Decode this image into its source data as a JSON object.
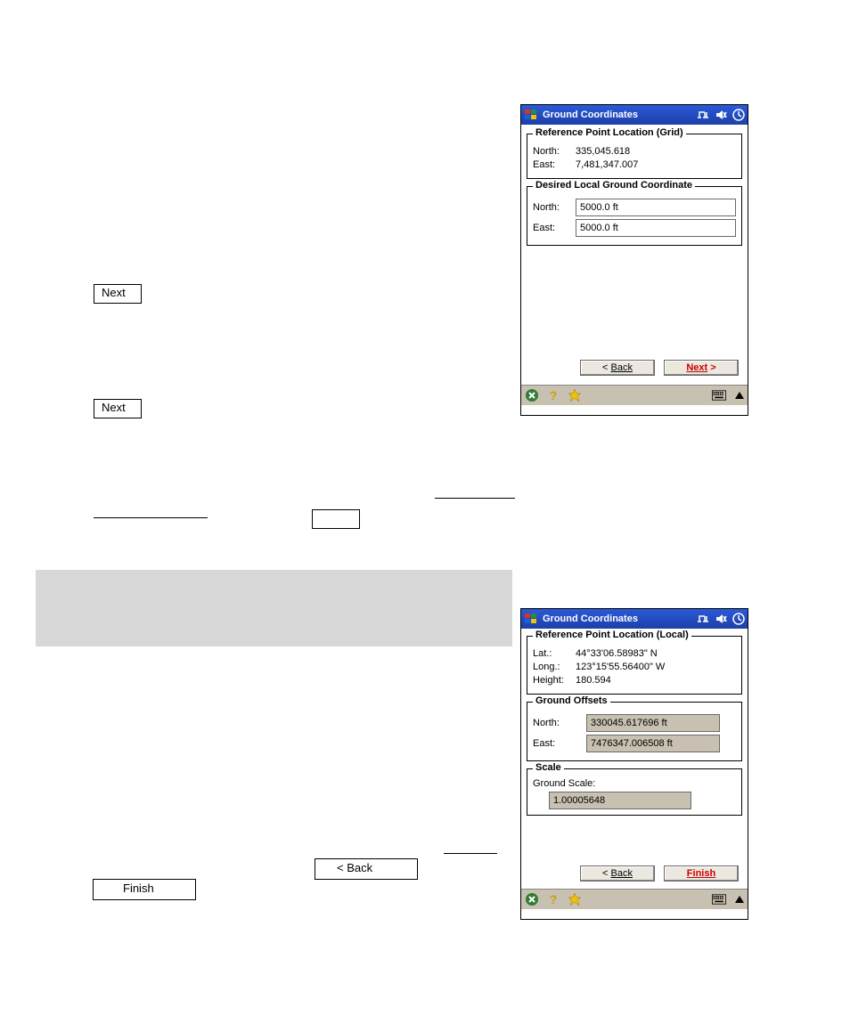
{
  "doc": {
    "step_refs": {
      "nextA": "Next",
      "nextB": "Next",
      "backC": "< Back",
      "finishC": "Finish"
    }
  },
  "deviceA": {
    "title": "Ground Coordinates",
    "group1": {
      "legend": "Reference Point Location (Grid)",
      "north_label": "North:",
      "north_value": "335,045.618",
      "east_label": "East:",
      "east_value": "7,481,347.007"
    },
    "group2": {
      "legend": "Desired Local Ground Coordinate",
      "north_label": "North:",
      "north_value": "5000.0 ft",
      "east_label": "East:",
      "east_value": "5000.0 ft"
    },
    "back_label": "Back",
    "next_label": "Next"
  },
  "deviceB": {
    "title": "Ground Coordinates",
    "group1": {
      "legend": "Reference Point Location (Local)",
      "lat_label": "Lat.:",
      "lat_value": "44°33'06.58983\" N",
      "long_label": "Long.:",
      "long_value": "123°15'55.56400\" W",
      "height_label": "Height:",
      "height_value": "180.594"
    },
    "group2": {
      "legend": "Ground Offsets",
      "north_label": "North:",
      "north_value": "330045.617696 ft",
      "east_label": "East:",
      "east_value": "7476347.006508 ft"
    },
    "group3": {
      "legend": "Scale",
      "scale_label": "Ground Scale:",
      "scale_value": "1.00005648"
    },
    "back_label": "Back",
    "finish_label": "Finish"
  }
}
